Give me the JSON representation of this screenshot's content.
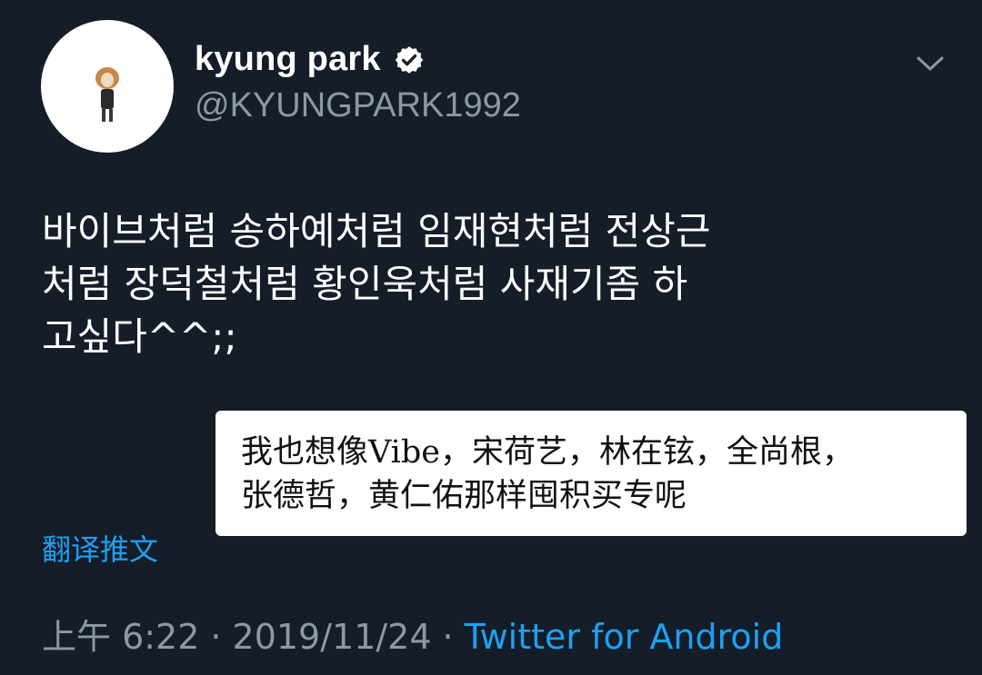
{
  "header": {
    "display_name": "kyung park",
    "handle": "@KYUNGPARK1992",
    "verified_icon": "verified-badge-icon",
    "menu_icon": "chevron-down-icon"
  },
  "tweet": {
    "lines": [
      "바이브처럼 송하예처럼 임재현처럼 전상근",
      "처럼 장덕철처럼 황인욱처럼 사재기좀 하",
      "고싶다^^;;"
    ]
  },
  "translation_overlay": {
    "lines": [
      "我也想像Vibe，宋荷艺，林在铉，全尚根，",
      "张德哲，黄仁佑那样囤积买专呢"
    ]
  },
  "translate_link": "翻译推文",
  "meta": {
    "time": "上午 6:22",
    "separator": "·",
    "date": "2019/11/24",
    "source": "Twitter for Android"
  },
  "colors": {
    "background": "#151d29",
    "link": "#1da1f2",
    "muted": "#8b98a5"
  }
}
